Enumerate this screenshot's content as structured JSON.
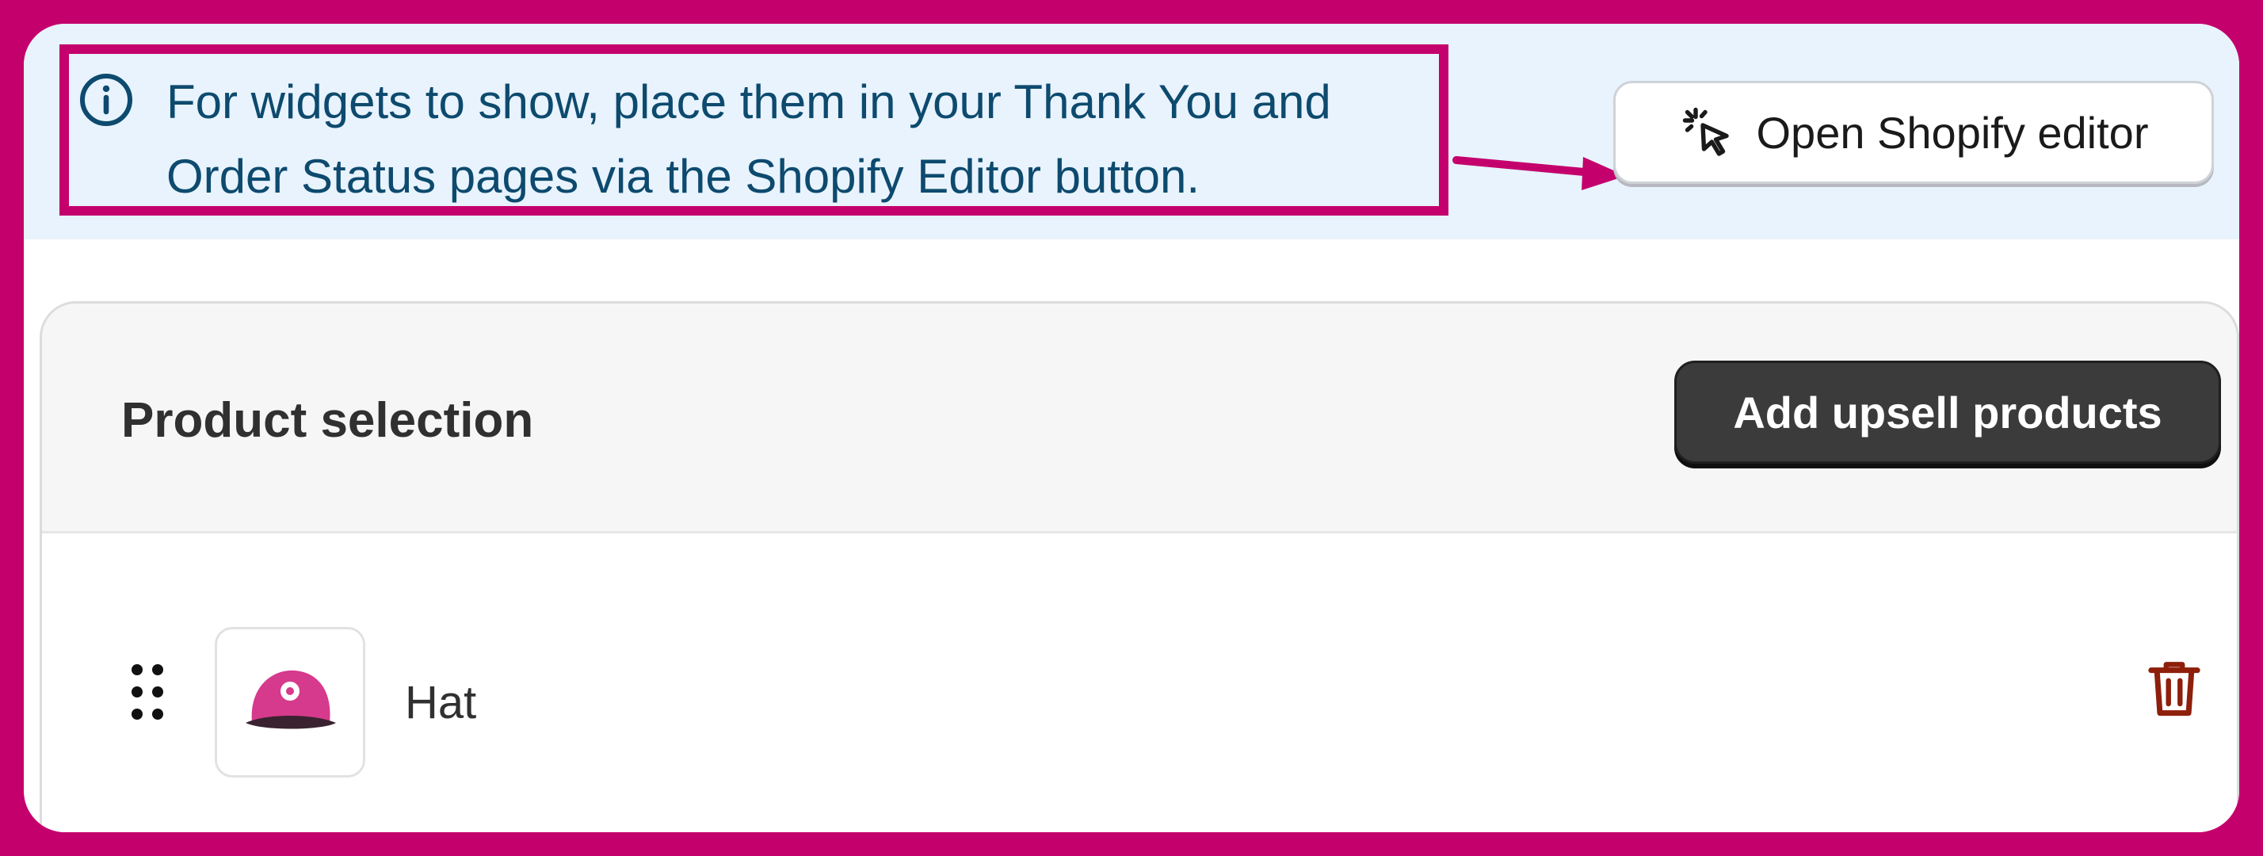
{
  "banner": {
    "line1": "For widgets to show, place them in your Thank You and",
    "line2": "Order Status pages via the Shopify Editor button.",
    "icon": "info-icon",
    "open_editor_label": "Open Shopify editor",
    "open_editor_icon": "cursor-click-icon"
  },
  "product_selection": {
    "title": "Product selection",
    "add_button_label": "Add upsell products",
    "items": [
      {
        "name": "Hat",
        "thumbnail_icon": "cap-icon",
        "drag_icon": "drag-handle-icon",
        "delete_icon": "trash-icon"
      }
    ]
  },
  "colors": {
    "frame": "#c4006d",
    "banner_bg": "#e8f3fd",
    "banner_text": "#0d4a6e",
    "primary_button": "#3b3b3b",
    "delete": "#8e1f0b"
  }
}
